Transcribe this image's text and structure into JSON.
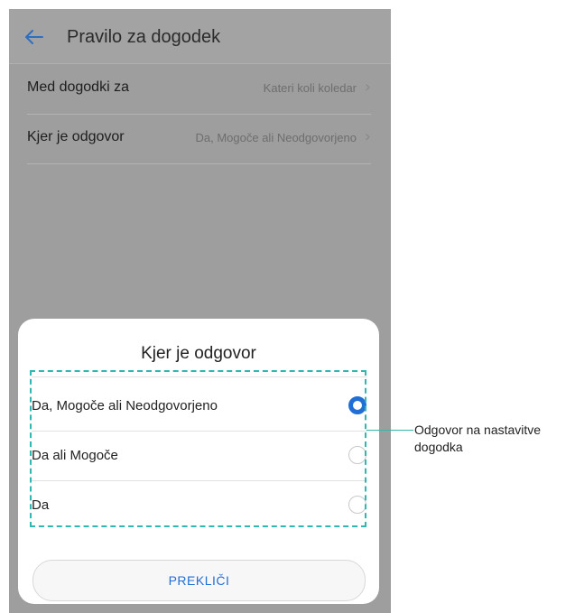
{
  "topbar": {
    "title": "Pravilo za dogodek"
  },
  "settings": [
    {
      "label": "Med dogodki za",
      "value": "Kateri koli koledar"
    },
    {
      "label": "Kjer je odgovor",
      "value": "Da, Mogoče ali Neodgovorjeno"
    }
  ],
  "dialog": {
    "title": "Kjer je odgovor",
    "options": [
      {
        "label": "Da, Mogoče ali Neodgovorjeno",
        "selected": true
      },
      {
        "label": "Da ali Mogoče",
        "selected": false
      },
      {
        "label": "Da",
        "selected": false
      }
    ],
    "cancel_label": "PREKLIČI"
  },
  "annotation": {
    "text": "Odgovor na nastavitve dogodka"
  },
  "colors": {
    "accent": "#1f6fd6",
    "annotation": "#2fb7b0"
  }
}
